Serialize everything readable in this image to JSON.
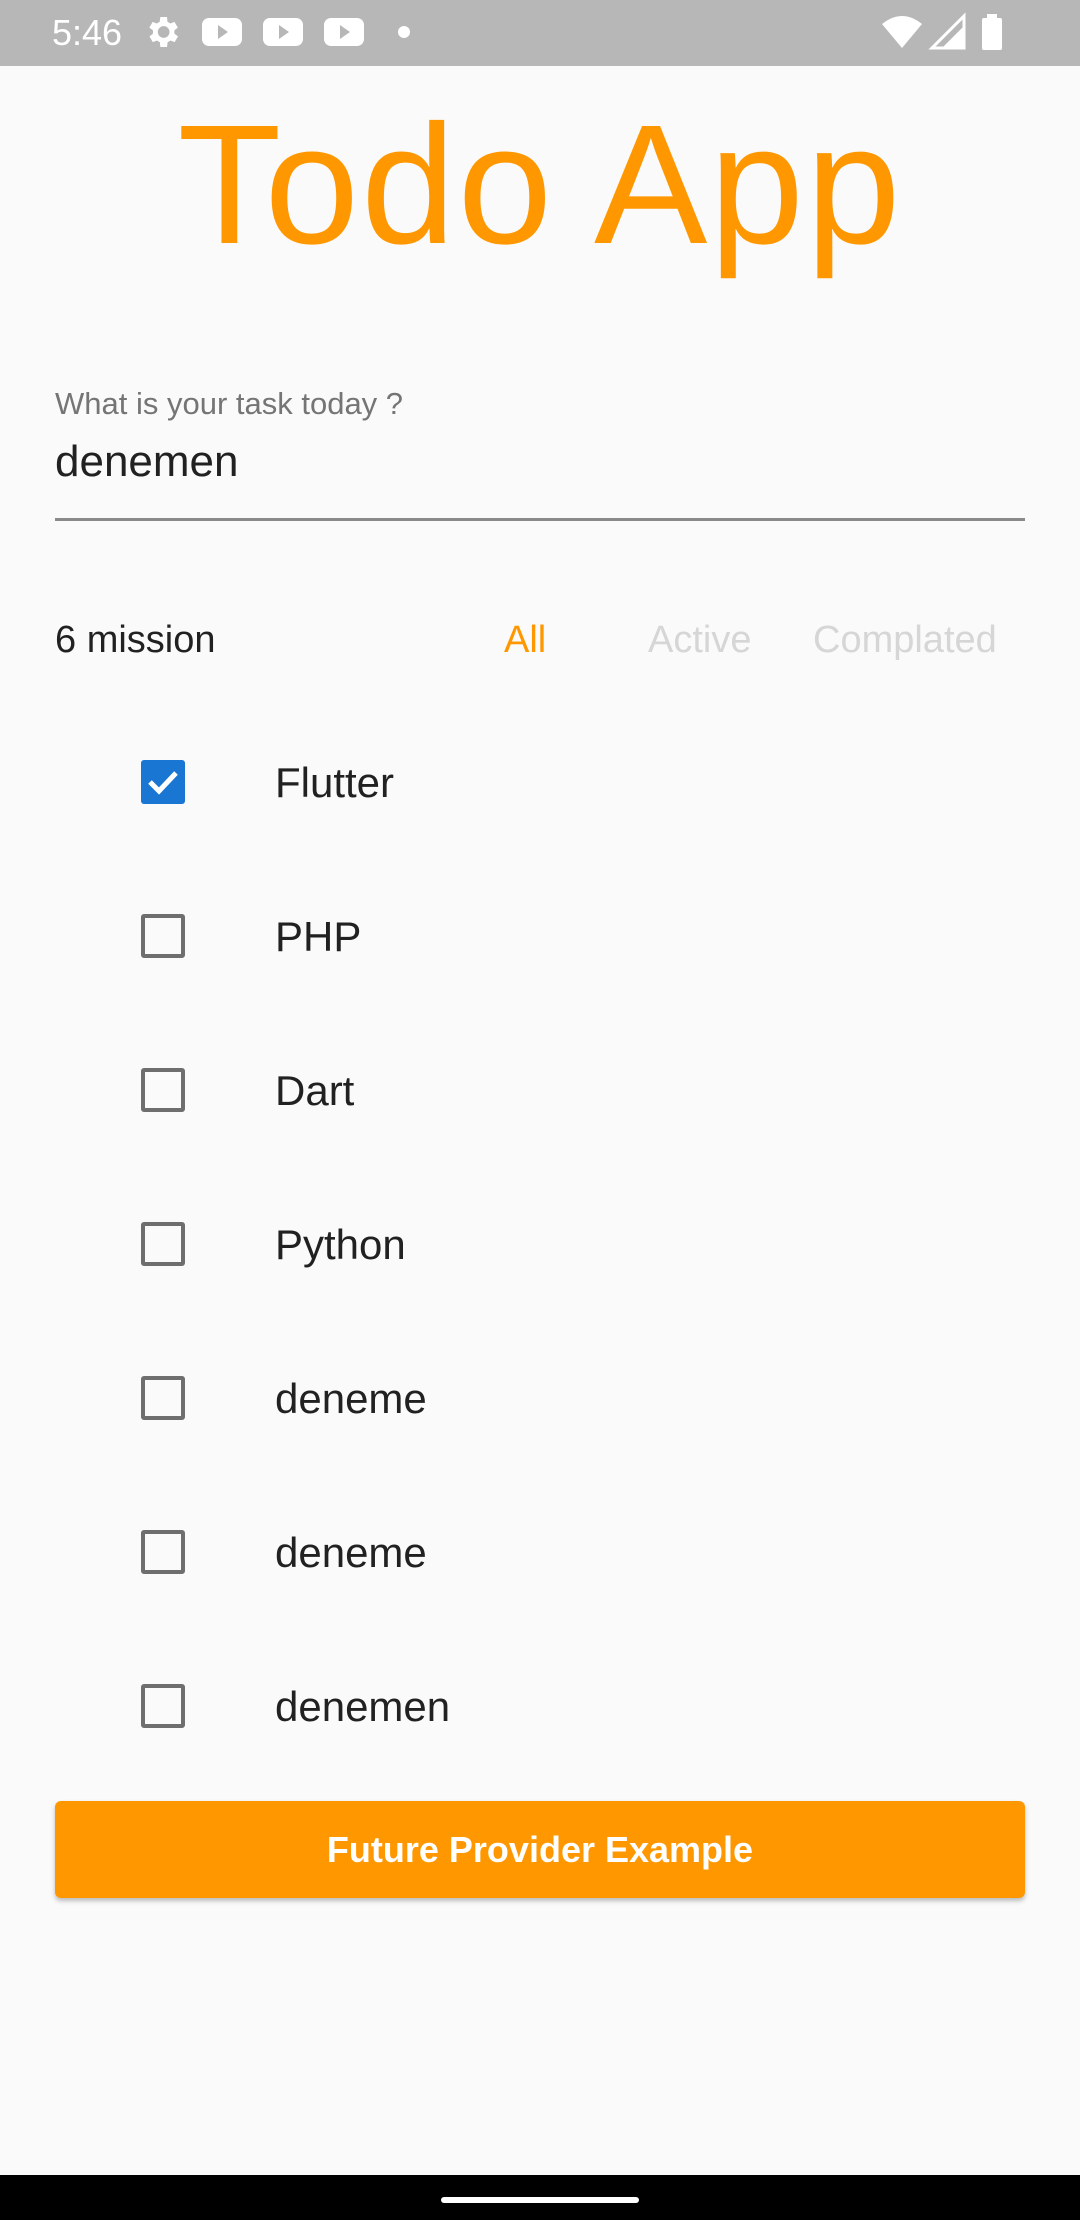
{
  "status_bar": {
    "time": "5:46",
    "icons_left": [
      "gear-icon",
      "youtube-icon",
      "youtube-icon",
      "youtube-icon",
      "dot-icon"
    ],
    "icons_right": [
      "wifi-icon",
      "signal-icon",
      "battery-icon"
    ]
  },
  "app": {
    "title": "Todo App",
    "accent_color": "#FF9800"
  },
  "task_input": {
    "label": "What is your task today ?",
    "value": "denemen"
  },
  "filters": {
    "count_label": "6 mission",
    "all": "All",
    "active": "Active",
    "completed": "Complated",
    "selected": "All"
  },
  "todos": [
    {
      "label": "Flutter",
      "checked": true
    },
    {
      "label": "PHP",
      "checked": false
    },
    {
      "label": "Dart",
      "checked": false
    },
    {
      "label": "Python",
      "checked": false
    },
    {
      "label": "deneme",
      "checked": false
    },
    {
      "label": "deneme",
      "checked": false
    },
    {
      "label": "denemen",
      "checked": false
    }
  ],
  "button": {
    "label": "Future Provider Example"
  }
}
